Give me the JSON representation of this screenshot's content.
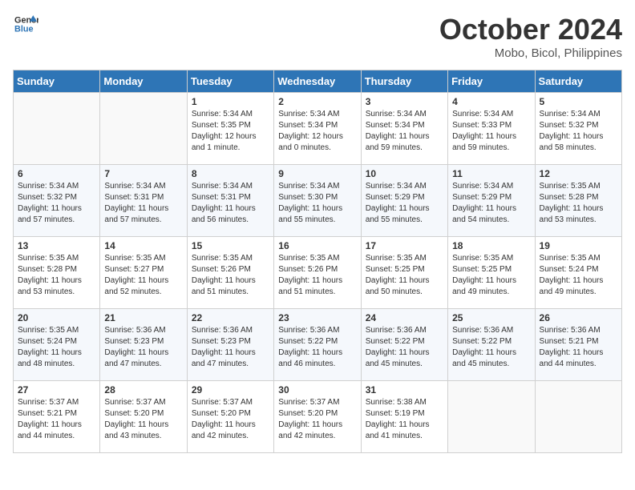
{
  "header": {
    "logo_line1": "General",
    "logo_line2": "Blue",
    "month": "October 2024",
    "location": "Mobo, Bicol, Philippines"
  },
  "columns": [
    "Sunday",
    "Monday",
    "Tuesday",
    "Wednesday",
    "Thursday",
    "Friday",
    "Saturday"
  ],
  "weeks": [
    [
      {
        "day": "",
        "info": ""
      },
      {
        "day": "",
        "info": ""
      },
      {
        "day": "1",
        "info": "Sunrise: 5:34 AM\nSunset: 5:35 PM\nDaylight: 12 hours\nand 1 minute."
      },
      {
        "day": "2",
        "info": "Sunrise: 5:34 AM\nSunset: 5:34 PM\nDaylight: 12 hours\nand 0 minutes."
      },
      {
        "day": "3",
        "info": "Sunrise: 5:34 AM\nSunset: 5:34 PM\nDaylight: 11 hours\nand 59 minutes."
      },
      {
        "day": "4",
        "info": "Sunrise: 5:34 AM\nSunset: 5:33 PM\nDaylight: 11 hours\nand 59 minutes."
      },
      {
        "day": "5",
        "info": "Sunrise: 5:34 AM\nSunset: 5:32 PM\nDaylight: 11 hours\nand 58 minutes."
      }
    ],
    [
      {
        "day": "6",
        "info": "Sunrise: 5:34 AM\nSunset: 5:32 PM\nDaylight: 11 hours\nand 57 minutes."
      },
      {
        "day": "7",
        "info": "Sunrise: 5:34 AM\nSunset: 5:31 PM\nDaylight: 11 hours\nand 57 minutes."
      },
      {
        "day": "8",
        "info": "Sunrise: 5:34 AM\nSunset: 5:31 PM\nDaylight: 11 hours\nand 56 minutes."
      },
      {
        "day": "9",
        "info": "Sunrise: 5:34 AM\nSunset: 5:30 PM\nDaylight: 11 hours\nand 55 minutes."
      },
      {
        "day": "10",
        "info": "Sunrise: 5:34 AM\nSunset: 5:29 PM\nDaylight: 11 hours\nand 55 minutes."
      },
      {
        "day": "11",
        "info": "Sunrise: 5:34 AM\nSunset: 5:29 PM\nDaylight: 11 hours\nand 54 minutes."
      },
      {
        "day": "12",
        "info": "Sunrise: 5:35 AM\nSunset: 5:28 PM\nDaylight: 11 hours\nand 53 minutes."
      }
    ],
    [
      {
        "day": "13",
        "info": "Sunrise: 5:35 AM\nSunset: 5:28 PM\nDaylight: 11 hours\nand 53 minutes."
      },
      {
        "day": "14",
        "info": "Sunrise: 5:35 AM\nSunset: 5:27 PM\nDaylight: 11 hours\nand 52 minutes."
      },
      {
        "day": "15",
        "info": "Sunrise: 5:35 AM\nSunset: 5:26 PM\nDaylight: 11 hours\nand 51 minutes."
      },
      {
        "day": "16",
        "info": "Sunrise: 5:35 AM\nSunset: 5:26 PM\nDaylight: 11 hours\nand 51 minutes."
      },
      {
        "day": "17",
        "info": "Sunrise: 5:35 AM\nSunset: 5:25 PM\nDaylight: 11 hours\nand 50 minutes."
      },
      {
        "day": "18",
        "info": "Sunrise: 5:35 AM\nSunset: 5:25 PM\nDaylight: 11 hours\nand 49 minutes."
      },
      {
        "day": "19",
        "info": "Sunrise: 5:35 AM\nSunset: 5:24 PM\nDaylight: 11 hours\nand 49 minutes."
      }
    ],
    [
      {
        "day": "20",
        "info": "Sunrise: 5:35 AM\nSunset: 5:24 PM\nDaylight: 11 hours\nand 48 minutes."
      },
      {
        "day": "21",
        "info": "Sunrise: 5:36 AM\nSunset: 5:23 PM\nDaylight: 11 hours\nand 47 minutes."
      },
      {
        "day": "22",
        "info": "Sunrise: 5:36 AM\nSunset: 5:23 PM\nDaylight: 11 hours\nand 47 minutes."
      },
      {
        "day": "23",
        "info": "Sunrise: 5:36 AM\nSunset: 5:22 PM\nDaylight: 11 hours\nand 46 minutes."
      },
      {
        "day": "24",
        "info": "Sunrise: 5:36 AM\nSunset: 5:22 PM\nDaylight: 11 hours\nand 45 minutes."
      },
      {
        "day": "25",
        "info": "Sunrise: 5:36 AM\nSunset: 5:22 PM\nDaylight: 11 hours\nand 45 minutes."
      },
      {
        "day": "26",
        "info": "Sunrise: 5:36 AM\nSunset: 5:21 PM\nDaylight: 11 hours\nand 44 minutes."
      }
    ],
    [
      {
        "day": "27",
        "info": "Sunrise: 5:37 AM\nSunset: 5:21 PM\nDaylight: 11 hours\nand 44 minutes."
      },
      {
        "day": "28",
        "info": "Sunrise: 5:37 AM\nSunset: 5:20 PM\nDaylight: 11 hours\nand 43 minutes."
      },
      {
        "day": "29",
        "info": "Sunrise: 5:37 AM\nSunset: 5:20 PM\nDaylight: 11 hours\nand 42 minutes."
      },
      {
        "day": "30",
        "info": "Sunrise: 5:37 AM\nSunset: 5:20 PM\nDaylight: 11 hours\nand 42 minutes."
      },
      {
        "day": "31",
        "info": "Sunrise: 5:38 AM\nSunset: 5:19 PM\nDaylight: 11 hours\nand 41 minutes."
      },
      {
        "day": "",
        "info": ""
      },
      {
        "day": "",
        "info": ""
      }
    ]
  ]
}
